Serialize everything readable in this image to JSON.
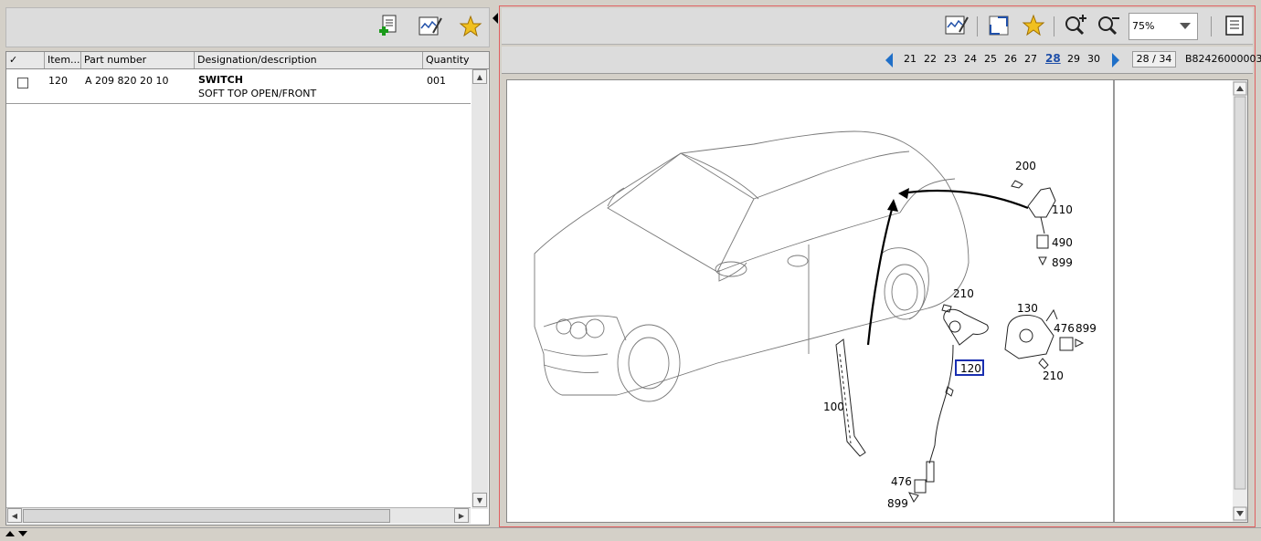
{
  "table": {
    "headers": [
      "✓",
      "Item...",
      "Part number",
      "Designation/description",
      "Quantity"
    ],
    "rows": [
      {
        "item": "120",
        "part_number": "A 209 820 20 10",
        "designation": "SWITCH",
        "description": "SOFT TOP OPEN/FRONT",
        "quantity": "001"
      }
    ]
  },
  "zoom": {
    "value": "75%"
  },
  "pager": {
    "pages": [
      "21",
      "22",
      "23",
      "24",
      "25",
      "26",
      "27",
      "28",
      "29",
      "30"
    ],
    "current": "28",
    "counter": "28 / 34",
    "doc_code": "B82426000003"
  },
  "drawing": {
    "callouts": {
      "c200": "200",
      "c110": "110",
      "c490": "490",
      "c899a": "899",
      "c210a": "210",
      "c130": "130",
      "c476a": "476",
      "c899b": "899",
      "c120": "120",
      "c210b": "210",
      "c100": "100",
      "c476b": "476",
      "c899c": "899"
    }
  },
  "colors": {
    "accent_blue": "#1f4fa8",
    "pane_border": "#e06060",
    "callout_highlight": "#1a2fb0"
  }
}
